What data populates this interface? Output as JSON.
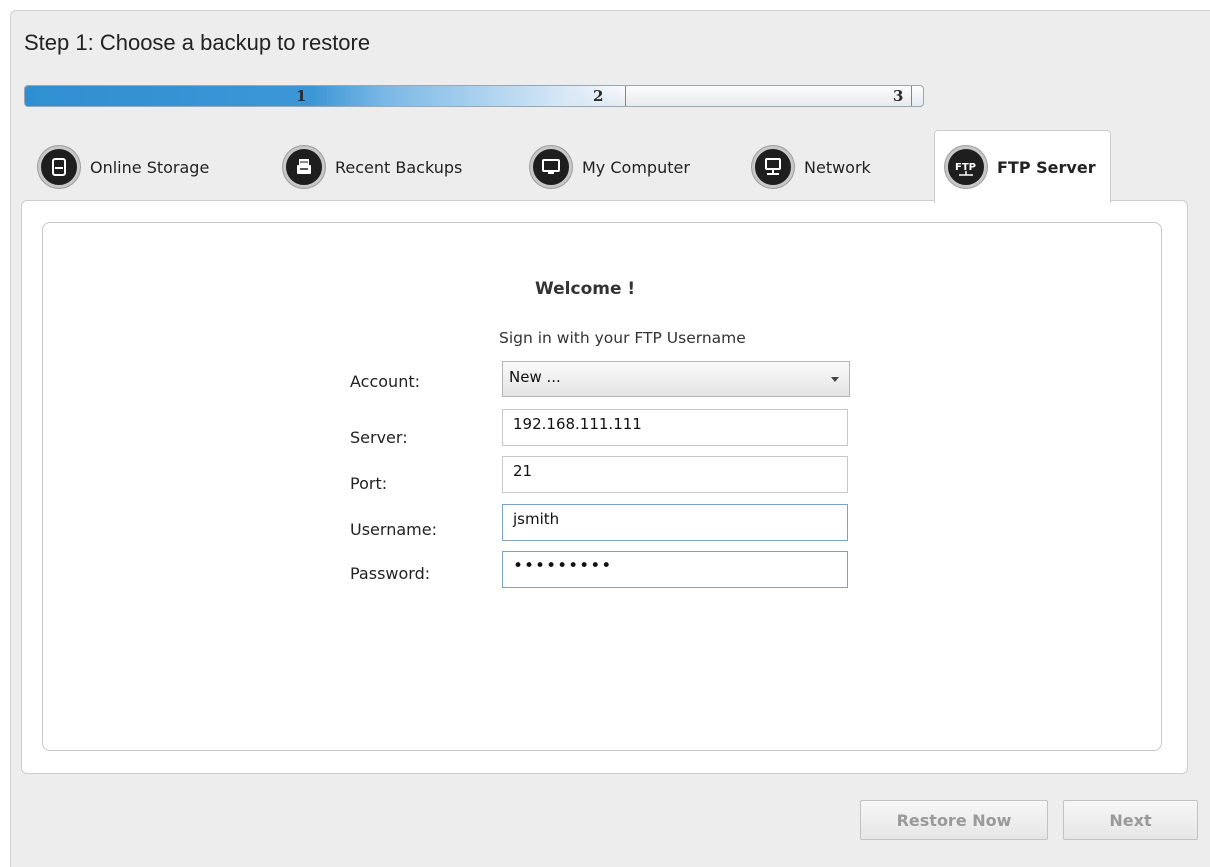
{
  "wizard": {
    "title": "Step 1: Choose a backup to restore",
    "steps": [
      "1",
      "2",
      "3"
    ],
    "progress_fraction": 0.33
  },
  "tabs": [
    {
      "label": "Online Storage",
      "icon": "online-storage-icon"
    },
    {
      "label": "Recent Backups",
      "icon": "recent-backups-icon"
    },
    {
      "label": "My Computer",
      "icon": "my-computer-icon"
    },
    {
      "label": "Network",
      "icon": "network-icon"
    },
    {
      "label": "FTP Server",
      "icon": "ftp-server-icon",
      "active": true
    }
  ],
  "form": {
    "welcome": "Welcome !",
    "subtitle": "Sign in with your FTP Username",
    "account_label": "Account:",
    "account_value": "New ...",
    "server_label": "Server:",
    "server_value": "192.168.111.111",
    "port_label": "Port:",
    "port_value": "21",
    "username_label": "Username:",
    "username_value": "jsmith",
    "password_label": "Password:",
    "password_value": "•••••••••"
  },
  "buttons": {
    "restore_now": "Restore Now",
    "next": "Next"
  },
  "colors": {
    "progress_fill": "#2f8fd0",
    "window_bg": "#ededed"
  }
}
